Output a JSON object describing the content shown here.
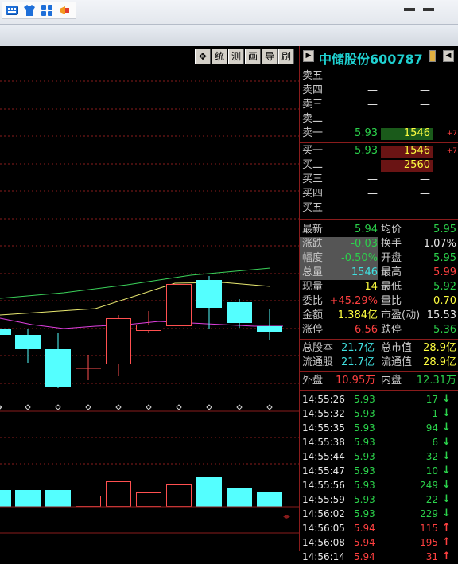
{
  "toolbar_buttons": [
    {
      "icon": "move-icon",
      "label": "✥"
    },
    {
      "icon": "",
      "label": "统"
    },
    {
      "icon": "",
      "label": "测"
    },
    {
      "icon": "",
      "label": "画"
    },
    {
      "icon": "",
      "label": "导"
    },
    {
      "icon": "",
      "label": "刷"
    }
  ],
  "stock": {
    "name": "中储股份",
    "code": "600787"
  },
  "asks": [
    {
      "label": "卖五",
      "price": "—",
      "vol": "—",
      "chg": ""
    },
    {
      "label": "卖四",
      "price": "—",
      "vol": "—",
      "chg": ""
    },
    {
      "label": "卖三",
      "price": "—",
      "vol": "—",
      "chg": ""
    },
    {
      "label": "卖二",
      "price": "—",
      "vol": "—",
      "chg": ""
    },
    {
      "label": "卖一",
      "price": "5.93",
      "vol": "1546",
      "chg": "+7"
    }
  ],
  "bids": [
    {
      "label": "买一",
      "price": "5.93",
      "vol": "1546",
      "chg": "+7"
    },
    {
      "label": "买二",
      "price": "—",
      "vol": "2560",
      "chg": ""
    },
    {
      "label": "买三",
      "price": "—",
      "vol": "—",
      "chg": ""
    },
    {
      "label": "买四",
      "price": "—",
      "vol": "—",
      "chg": ""
    },
    {
      "label": "买五",
      "price": "—",
      "vol": "—",
      "chg": ""
    }
  ],
  "quote_left": [
    {
      "label": "最新",
      "value": "5.94"
    },
    {
      "label": "涨跌",
      "value": "-0.03"
    },
    {
      "label": "幅度",
      "value": "-0.50%"
    },
    {
      "label": "总量",
      "value": "1546"
    },
    {
      "label": "现量",
      "value": "14"
    },
    {
      "label": "委比",
      "value": "+45.29%"
    },
    {
      "label": "金额",
      "value": "1.384亿"
    },
    {
      "label": "涨停",
      "value": "6.56"
    }
  ],
  "quote_right": [
    {
      "label": "均价",
      "value": "5.95"
    },
    {
      "label": "换手",
      "value": "1.07%"
    },
    {
      "label": "开盘",
      "value": "5.95"
    },
    {
      "label": "最高",
      "value": "5.99"
    },
    {
      "label": "最低",
      "value": "5.92"
    },
    {
      "label": "量比",
      "value": "0.70"
    },
    {
      "label": "市盈(动)",
      "value": "15.53"
    },
    {
      "label": "跌停",
      "value": "5.36"
    }
  ],
  "capital": [
    {
      "l1": "总股本",
      "v1": "21.7亿",
      "l2": "总市值",
      "v2": "28.9亿"
    },
    {
      "l1": "流通股",
      "v1": "21.7亿",
      "l2": "流通值",
      "v2": "28.9亿"
    }
  ],
  "outer_inner": {
    "out_label": "外盘",
    "out_value": "10.95万",
    "in_label": "内盘",
    "in_value": "12.31万"
  },
  "ticks": [
    {
      "time": "14:55:26",
      "price": "5.93",
      "vol": "17",
      "dir": "down"
    },
    {
      "time": "14:55:32",
      "price": "5.93",
      "vol": "1",
      "dir": "down"
    },
    {
      "time": "14:55:35",
      "price": "5.93",
      "vol": "94",
      "dir": "down"
    },
    {
      "time": "14:55:38",
      "price": "5.93",
      "vol": "6",
      "dir": "down"
    },
    {
      "time": "14:55:44",
      "price": "5.93",
      "vol": "32",
      "dir": "down"
    },
    {
      "time": "14:55:47",
      "price": "5.93",
      "vol": "10",
      "dir": "down"
    },
    {
      "time": "14:55:56",
      "price": "5.93",
      "vol": "249",
      "dir": "down"
    },
    {
      "time": "14:55:59",
      "price": "5.93",
      "vol": "22",
      "dir": "down"
    },
    {
      "time": "14:56:02",
      "price": "5.93",
      "vol": "229",
      "dir": "down"
    },
    {
      "time": "14:56:05",
      "price": "5.94",
      "vol": "115",
      "dir": "up"
    },
    {
      "time": "14:56:08",
      "price": "5.94",
      "vol": "195",
      "dir": "up"
    },
    {
      "time": "14:56:14",
      "price": "5.94",
      "vol": "31",
      "dir": "up"
    }
  ],
  "colors": {
    "up": "#ff4040",
    "down": "#2bd24b",
    "candle_down": "#54ffff",
    "candle_up": "#ff5050",
    "border": "#8a1c1c"
  }
}
